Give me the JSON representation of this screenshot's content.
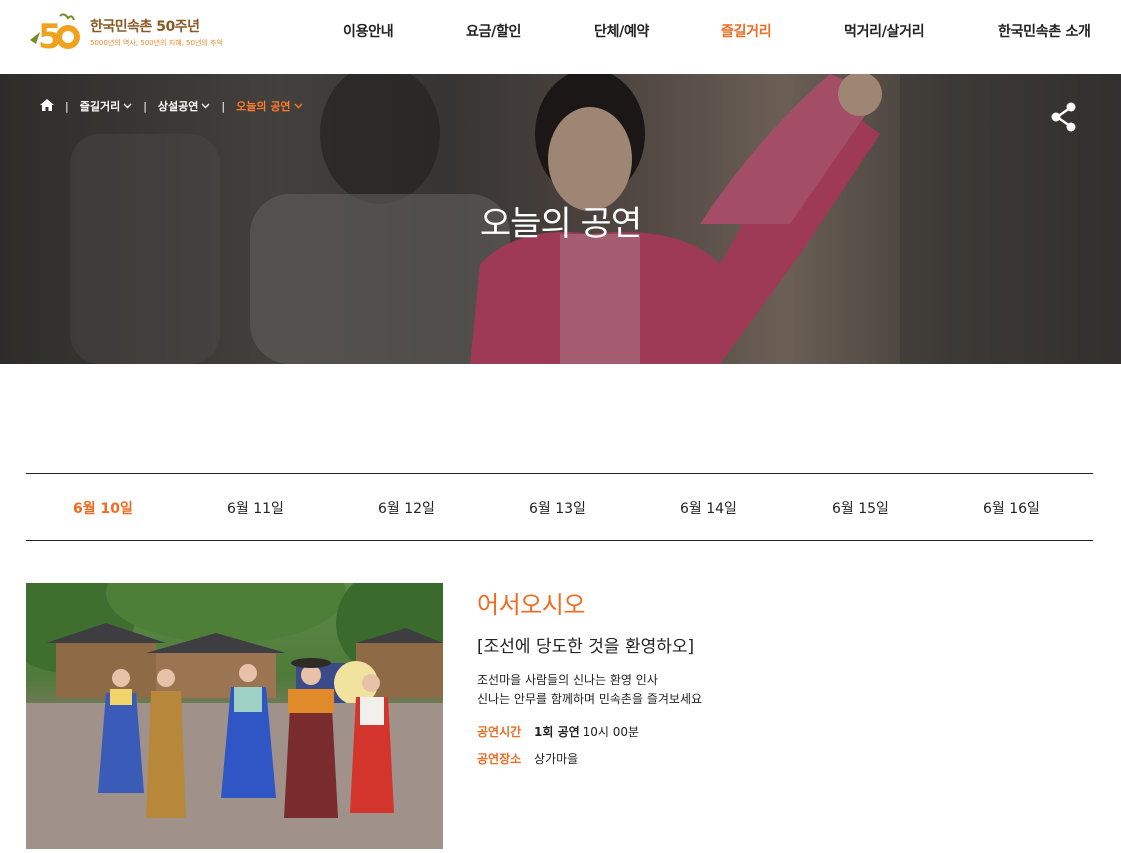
{
  "header": {
    "logo_title": "한국민속촌 50주년",
    "logo_subtitle": "5000년의 역사, 500년의 지혜, 50년의 추억",
    "nav": [
      "이용안내",
      "요금/할인",
      "단체/예약",
      "즐길거리",
      "먹거리/살거리",
      "한국민속촌 소개"
    ],
    "active_nav": "즐길거리"
  },
  "hero": {
    "breadcrumb": [
      "즐길거리",
      "상설공연",
      "오늘의 공연"
    ],
    "title": "오늘의 공연"
  },
  "dates": {
    "tabs": [
      "6월 10일",
      "6월 11일",
      "6월 12일",
      "6월 13일",
      "6월 14일",
      "6월 15일",
      "6월 16일"
    ],
    "active": "6월 10일"
  },
  "show": {
    "title": "어서오시오",
    "subtitle": "[조선에 당도한 것을 환영하오]",
    "desc_line1": "조선마을 사람들의 신나는 환영 인사",
    "desc_line2": "신나는 안무를 함께하며 민속촌을 즐겨보세요",
    "time_label": "공연시간",
    "time_round": "1회 공연",
    "time_value": "10시 00분",
    "place_label": "공연장소",
    "place_value": "상가마을"
  },
  "colors": {
    "accent": "#ee6b1f",
    "text": "#222222"
  },
  "icons": [
    "home-icon",
    "chevron-down-icon",
    "share-icon",
    "logo-50-icon"
  ]
}
